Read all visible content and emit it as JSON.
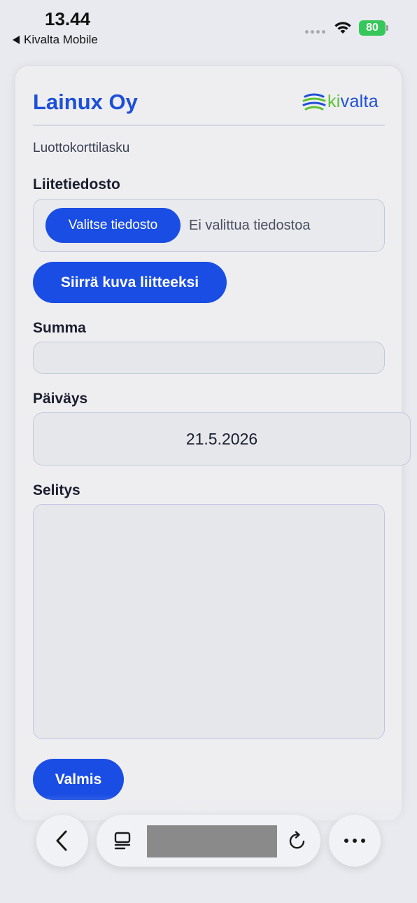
{
  "status_bar": {
    "time": "13.44",
    "back_app": "Kivalta Mobile",
    "battery": "80"
  },
  "header": {
    "company": "Lainux Oy",
    "logo_prefix": "ki",
    "logo_suffix": "valta"
  },
  "form": {
    "document_type": "Luottokorttilasku",
    "attachment_label": "Liitetiedosto",
    "choose_file_label": "Valitse tiedosto",
    "no_file_text": "Ei valittua tiedostoa",
    "attach_button_label": "Siirrä kuva liitteeksi",
    "amount_label": "Summa",
    "amount_value": "",
    "date_label": "Päiväys",
    "date_value": "21.5.2026",
    "description_label": "Selitys",
    "description_value": "",
    "done_button_label": "Valmis"
  },
  "colors": {
    "accent": "#1a4de3",
    "title": "#1d4fd8",
    "logo_green": "#5cc331",
    "battery_green": "#35c759"
  },
  "icons": {
    "back": "chevron-left-icon",
    "tabs": "tabs-icon",
    "reload": "reload-icon",
    "more": "more-icon",
    "wifi": "wifi-icon"
  }
}
